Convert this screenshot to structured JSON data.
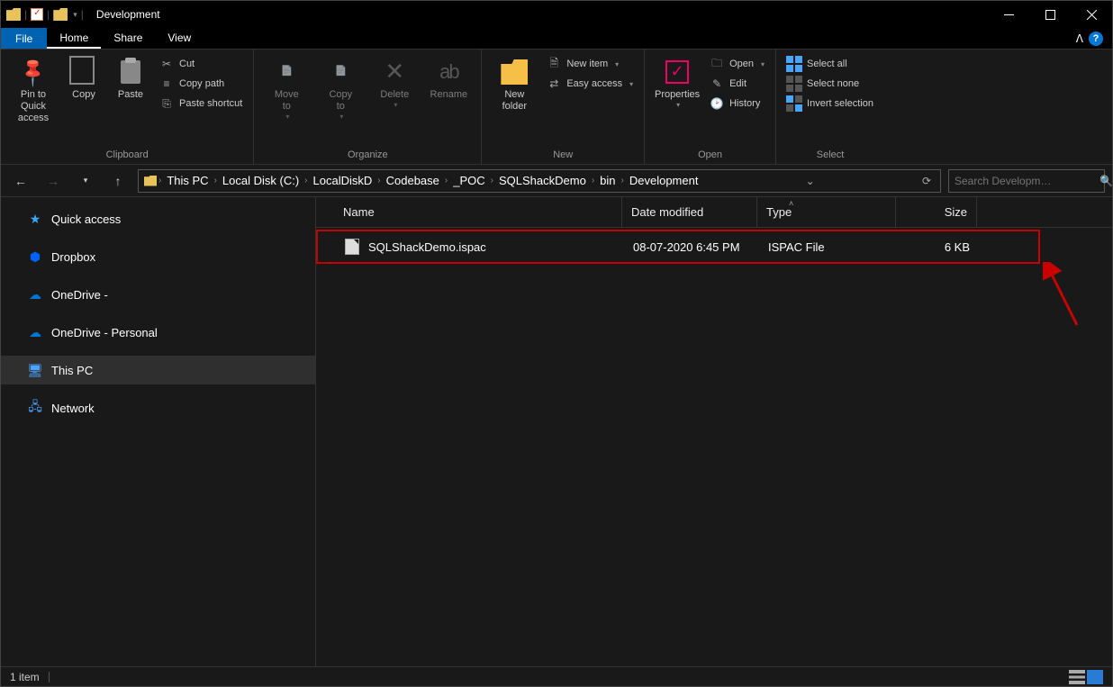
{
  "title": "Development",
  "tabs": {
    "file": "File",
    "home": "Home",
    "share": "Share",
    "view": "View"
  },
  "ribbon": {
    "clipboard": {
      "label": "Clipboard",
      "pin": "Pin to Quick\naccess",
      "copy": "Copy",
      "paste": "Paste",
      "cut": "Cut",
      "copypath": "Copy path",
      "pasteshortcut": "Paste shortcut"
    },
    "organize": {
      "label": "Organize",
      "moveto": "Move\nto",
      "copyto": "Copy\nto",
      "delete": "Delete",
      "rename": "Rename"
    },
    "new": {
      "label": "New",
      "newfolder": "New\nfolder",
      "newitem": "New item",
      "easyaccess": "Easy access"
    },
    "open": {
      "label": "Open",
      "properties": "Properties",
      "open": "Open",
      "edit": "Edit",
      "history": "History"
    },
    "select": {
      "label": "Select",
      "all": "Select all",
      "none": "Select none",
      "invert": "Invert selection"
    }
  },
  "breadcrumb": [
    "This PC",
    "Local Disk (C:)",
    "LocalDiskD",
    "Codebase",
    "_POC",
    "SQLShackDemo",
    "bin",
    "Development"
  ],
  "search_placeholder": "Search Developm…",
  "nav": {
    "quick": "Quick access",
    "dropbox": "Dropbox",
    "onedrive1": "OneDrive -",
    "onedrive2": "OneDrive - Personal",
    "thispc": "This PC",
    "network": "Network"
  },
  "columns": {
    "name": "Name",
    "date": "Date modified",
    "type": "Type",
    "size": "Size"
  },
  "files": [
    {
      "name": "SQLShackDemo.ispac",
      "date": "08-07-2020 6:45 PM",
      "type": "ISPAC File",
      "size": "6 KB"
    }
  ],
  "status": "1 item"
}
